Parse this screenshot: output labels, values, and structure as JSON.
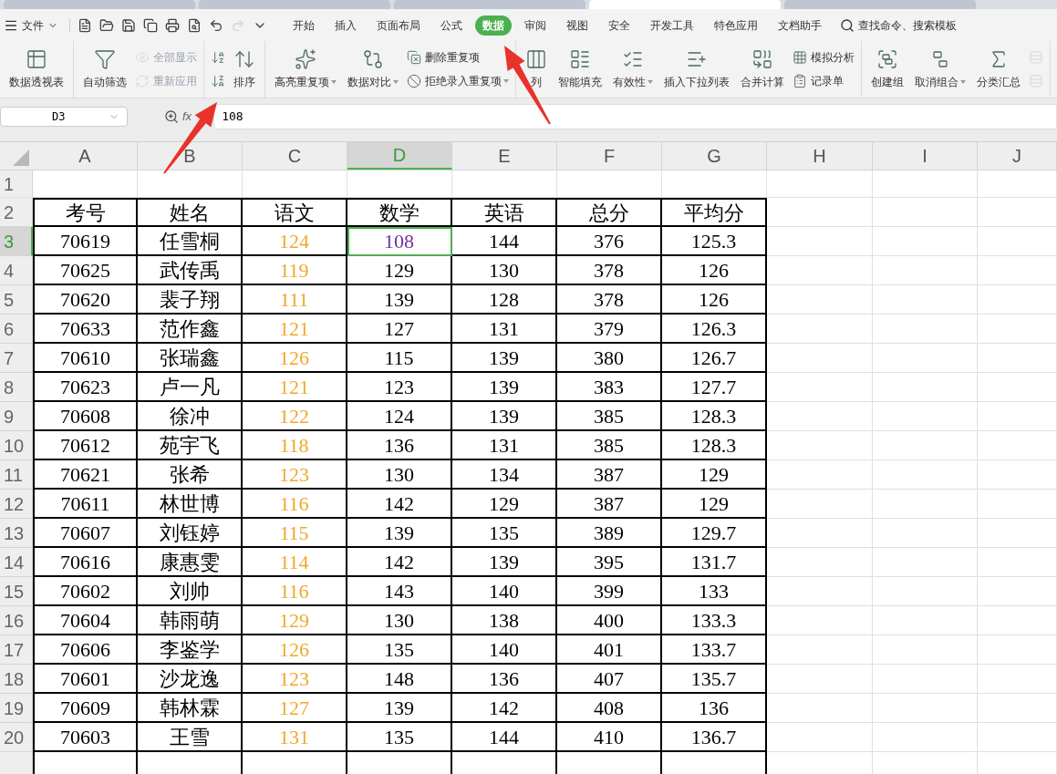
{
  "title_bar": {
    "tabs": [
      {
        "selected": false
      },
      {
        "selected": false
      },
      {
        "selected": false
      },
      {
        "selected": true
      },
      {
        "selected": false
      }
    ]
  },
  "menu": {
    "file": "文件",
    "tabs": [
      {
        "label": "开始",
        "selected": false
      },
      {
        "label": "插入",
        "selected": false
      },
      {
        "label": "页面布局",
        "selected": false
      },
      {
        "label": "公式",
        "selected": false
      },
      {
        "label": "数据",
        "selected": true
      },
      {
        "label": "审阅",
        "selected": false
      },
      {
        "label": "视图",
        "selected": false
      },
      {
        "label": "安全",
        "selected": false
      },
      {
        "label": "开发工具",
        "selected": false
      },
      {
        "label": "特色应用",
        "selected": false
      },
      {
        "label": "文档助手",
        "selected": false
      }
    ],
    "search": "查找命令、搜索模板"
  },
  "ribbon": [
    {
      "items": [
        {
          "kind": "large",
          "label": "数据透视表",
          "disabled": false,
          "dropdown": false
        }
      ]
    },
    {
      "items": [
        {
          "kind": "large",
          "label": "自动筛选",
          "disabled": false,
          "dropdown": false
        },
        {
          "kind": "small",
          "label": "全部显示",
          "disabled": true,
          "dropdown": false
        },
        {
          "kind": "small",
          "label": "重新应用",
          "disabled": true,
          "dropdown": false
        }
      ]
    },
    {
      "items": [
        {
          "kind": "icon",
          "disabled": false
        },
        {
          "kind": "icon",
          "disabled": false
        },
        {
          "kind": "large",
          "label": "排序",
          "disabled": false,
          "dropdown": false
        }
      ]
    },
    {
      "items": [
        {
          "kind": "large",
          "label": "高亮重复项",
          "disabled": false,
          "dropdown": true
        },
        {
          "kind": "large",
          "label": "数据对比",
          "disabled": false,
          "dropdown": true
        },
        {
          "kind": "small",
          "label": "删除重复项",
          "disabled": false,
          "dropdown": false
        },
        {
          "kind": "small",
          "label": "拒绝录入重复项",
          "disabled": false,
          "dropdown": true
        }
      ]
    },
    {
      "items": [
        {
          "kind": "large",
          "label": "列",
          "disabled": false,
          "dropdown": false
        },
        {
          "kind": "large",
          "label": "智能填充",
          "disabled": false,
          "dropdown": false
        },
        {
          "kind": "large",
          "label": "有效性",
          "disabled": false,
          "dropdown": true
        },
        {
          "kind": "large",
          "label": "插入下拉列表",
          "disabled": false,
          "dropdown": false
        },
        {
          "kind": "large",
          "label": "合并计算",
          "disabled": false,
          "dropdown": false
        },
        {
          "kind": "small",
          "label": "模拟分析",
          "disabled": false,
          "dropdown": false
        },
        {
          "kind": "small",
          "label": "记录单",
          "disabled": false,
          "dropdown": false
        }
      ]
    },
    {
      "items": [
        {
          "kind": "large",
          "label": "创建组",
          "disabled": false,
          "dropdown": false
        },
        {
          "kind": "large",
          "label": "取消组合",
          "disabled": false,
          "dropdown": true
        },
        {
          "kind": "large",
          "label": "分类汇总",
          "disabled": false,
          "dropdown": false
        },
        {
          "kind": "icon",
          "disabled": true
        },
        {
          "kind": "icon",
          "disabled": true
        }
      ]
    }
  ],
  "name_box": "D3",
  "fx": "fx",
  "formula": "108",
  "columns": [
    {
      "letter": "A",
      "selected": false
    },
    {
      "letter": "B",
      "selected": false
    },
    {
      "letter": "C",
      "selected": false
    },
    {
      "letter": "D",
      "selected": true
    },
    {
      "letter": "E",
      "selected": false
    },
    {
      "letter": "F",
      "selected": false
    },
    {
      "letter": "G",
      "selected": false
    },
    {
      "letter": "H",
      "selected": false
    },
    {
      "letter": "I",
      "selected": false
    },
    {
      "letter": "J",
      "selected": false
    }
  ],
  "active_cell": {
    "color": "#7030a0"
  },
  "table": {
    "heading_row": "2",
    "fields": [
      {
        "heading": "考号",
        "color": "#000000"
      },
      {
        "heading": "姓名",
        "color": "#000000"
      },
      {
        "heading": "语文",
        "color": "#f0a82c"
      },
      {
        "heading": "数学",
        "color": "#000000"
      },
      {
        "heading": "英语",
        "color": "#000000"
      },
      {
        "heading": "总分",
        "color": "#000000"
      },
      {
        "heading": "平均分",
        "color": "#000000"
      }
    ],
    "rows": [
      {
        "number": "3",
        "selected": true,
        "cells": [
          "70619",
          "任雪桐",
          "124",
          "108",
          "144",
          "376",
          "125.3"
        ]
      },
      {
        "number": "4",
        "selected": false,
        "cells": [
          "70625",
          "武传禹",
          "119",
          "129",
          "130",
          "378",
          "126"
        ]
      },
      {
        "number": "5",
        "selected": false,
        "cells": [
          "70620",
          "裴子翔",
          "111",
          "139",
          "128",
          "378",
          "126"
        ]
      },
      {
        "number": "6",
        "selected": false,
        "cells": [
          "70633",
          "范作鑫",
          "121",
          "127",
          "131",
          "379",
          "126.3"
        ]
      },
      {
        "number": "7",
        "selected": false,
        "cells": [
          "70610",
          "张瑞鑫",
          "126",
          "115",
          "139",
          "380",
          "126.7"
        ]
      },
      {
        "number": "8",
        "selected": false,
        "cells": [
          "70623",
          "卢一凡",
          "121",
          "123",
          "139",
          "383",
          "127.7"
        ]
      },
      {
        "number": "9",
        "selected": false,
        "cells": [
          "70608",
          "徐冲",
          "122",
          "124",
          "139",
          "385",
          "128.3"
        ]
      },
      {
        "number": "10",
        "selected": false,
        "cells": [
          "70612",
          "苑宇飞",
          "118",
          "136",
          "131",
          "385",
          "128.3"
        ]
      },
      {
        "number": "11",
        "selected": false,
        "cells": [
          "70621",
          "张希",
          "123",
          "130",
          "134",
          "387",
          "129"
        ]
      },
      {
        "number": "12",
        "selected": false,
        "cells": [
          "70611",
          "林世博",
          "116",
          "142",
          "129",
          "387",
          "129"
        ]
      },
      {
        "number": "13",
        "selected": false,
        "cells": [
          "70607",
          "刘钰婷",
          "115",
          "139",
          "135",
          "389",
          "129.7"
        ]
      },
      {
        "number": "14",
        "selected": false,
        "cells": [
          "70616",
          "康惠雯",
          "114",
          "142",
          "139",
          "395",
          "131.7"
        ]
      },
      {
        "number": "15",
        "selected": false,
        "cells": [
          "70602",
          "刘帅",
          "116",
          "143",
          "140",
          "399",
          "133"
        ]
      },
      {
        "number": "16",
        "selected": false,
        "cells": [
          "70604",
          "韩雨萌",
          "129",
          "130",
          "138",
          "400",
          "133.3"
        ]
      },
      {
        "number": "17",
        "selected": false,
        "cells": [
          "70606",
          "李鉴学",
          "126",
          "135",
          "140",
          "401",
          "133.7"
        ]
      },
      {
        "number": "18",
        "selected": false,
        "cells": [
          "70601",
          "沙龙逸",
          "123",
          "148",
          "136",
          "407",
          "135.7"
        ]
      },
      {
        "number": "19",
        "selected": false,
        "cells": [
          "70609",
          "韩林霖",
          "127",
          "139",
          "142",
          "408",
          "136"
        ]
      },
      {
        "number": "20",
        "selected": false,
        "cells": [
          "70603",
          "王雪",
          "131",
          "135",
          "144",
          "410",
          "136.7"
        ]
      }
    ]
  },
  "empty_rows": [
    "1"
  ]
}
